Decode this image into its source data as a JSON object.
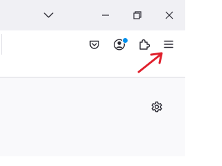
{
  "titlebar": {
    "icons": [
      "chevron-down-icon",
      "minimize-icon",
      "restore-icon",
      "close-icon"
    ]
  },
  "toolbar": {
    "icons": [
      "pocket-icon",
      "account-icon",
      "extensions-icon",
      "app-menu-icon"
    ],
    "account_badge_color": "#0090ed"
  },
  "content": {
    "icons": [
      "settings-gear-icon"
    ]
  },
  "annotation": {
    "arrow_color": "#e0202c"
  },
  "colors": {
    "titlebar_bg": "#f0f0f4",
    "toolbar_bg": "#ffffff",
    "content_bg": "#f9f9fb",
    "icon": "#2b2a33"
  }
}
